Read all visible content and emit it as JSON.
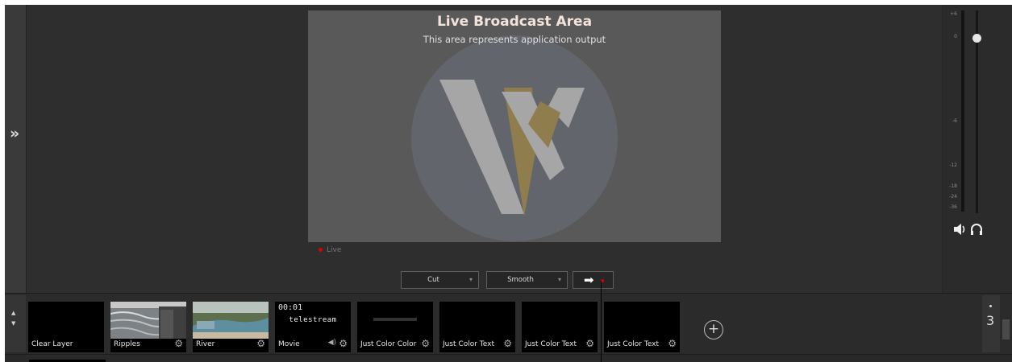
{
  "preview": {
    "title": "Live Broadcast Area",
    "subtitle": "This area represents application output",
    "live_label": "Live",
    "logo_icon": "wirecast-logo-icon"
  },
  "sidebar": {
    "expand_icon": "double-chevron-right-icon",
    "expand_glyph": "»"
  },
  "transition": {
    "first": "Cut",
    "second": "Smooth",
    "go_icon": "arrow-right-icon",
    "go_glyph": "➡"
  },
  "meter": {
    "scale": [
      "+6",
      "0",
      "-6",
      "-12",
      "-18",
      "-24",
      "-36"
    ],
    "fader_level_db": 0,
    "speaker_icon": "speaker-icon",
    "headphone_icon": "headphones-icon"
  },
  "layer": {
    "number": "3",
    "add_glyph": "+",
    "shots": [
      {
        "name": "Clear Layer"
      },
      {
        "name": "Ripples",
        "settings": true
      },
      {
        "name": "River",
        "settings": true
      },
      {
        "name": "Movie",
        "time": "00:01",
        "brand": "telestream",
        "audio": true,
        "settings": true
      },
      {
        "name": "Just Color Color",
        "settings": true
      },
      {
        "name": "Just Color Text",
        "settings": true
      },
      {
        "name": "Just Color Text",
        "settings": true
      },
      {
        "name": "Just Color Text",
        "settings": true
      }
    ]
  },
  "colors": {
    "background": "#2e2e2e",
    "preview": "#595959",
    "live_red": "#e00000",
    "logo_accent": "#c4a043"
  }
}
